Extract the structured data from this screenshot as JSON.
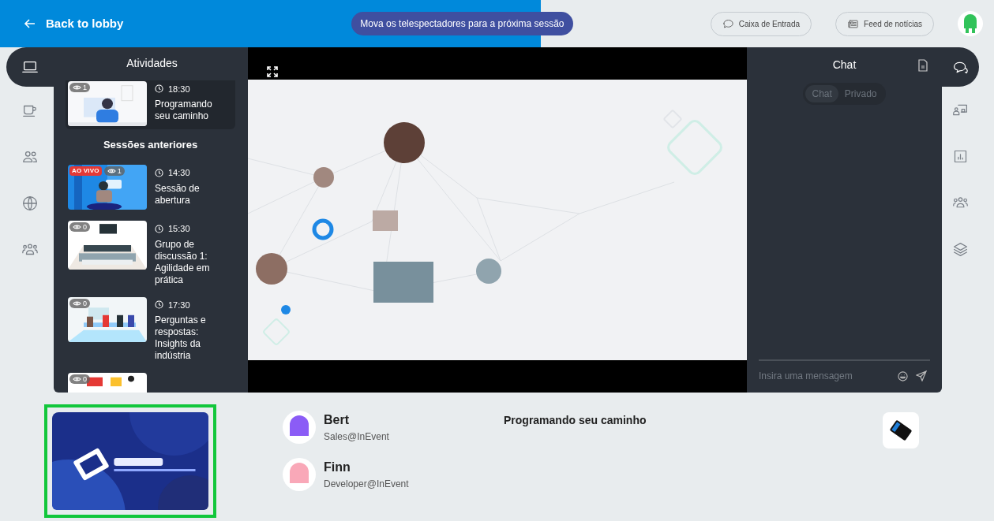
{
  "header": {
    "back_label": "Back to lobby",
    "banner": "Mova os telespectadores para a próxima sessão",
    "buttons": [
      {
        "label": "Caixa de Entrada"
      },
      {
        "label": "Feed de notícias"
      }
    ]
  },
  "left_rail": [
    {
      "selected": true
    },
    {
      "selected": false
    },
    {
      "selected": false
    },
    {
      "selected": false
    },
    {
      "selected": false
    }
  ],
  "activities": {
    "title": "Atividades",
    "current": {
      "views": "1",
      "time": "18:30",
      "title": "Programando seu caminho"
    },
    "section": "Sessões anteriores",
    "sessions": [
      {
        "badge": "AO VIVO",
        "views": "1",
        "time": "14:30",
        "title": "Sessão de abertura"
      },
      {
        "views": "0",
        "time": "15:30",
        "title": "Grupo de discussão 1: Agilidade em prática"
      },
      {
        "views": "0",
        "time": "17:30",
        "title": "Perguntas e respostas: Insights da indústria"
      },
      {
        "views": "0"
      }
    ]
  },
  "chat": {
    "title": "Chat",
    "tabs": [
      {
        "label": "Chat",
        "selected": true
      },
      {
        "label": "Privado",
        "selected": false
      }
    ],
    "placeholder": "Insira uma mensagem"
  },
  "right_rail": [
    {
      "selected": true
    },
    {
      "selected": false
    },
    {
      "selected": false
    },
    {
      "selected": false
    },
    {
      "selected": false
    }
  ],
  "speakers": [
    {
      "name": "Bert",
      "role": "Sales@InEvent",
      "color": "#8b5cf6"
    },
    {
      "name": "Finn",
      "role": "Developer@InEvent",
      "color": "#f9a8b8"
    }
  ],
  "session_title": "Programando seu caminho"
}
